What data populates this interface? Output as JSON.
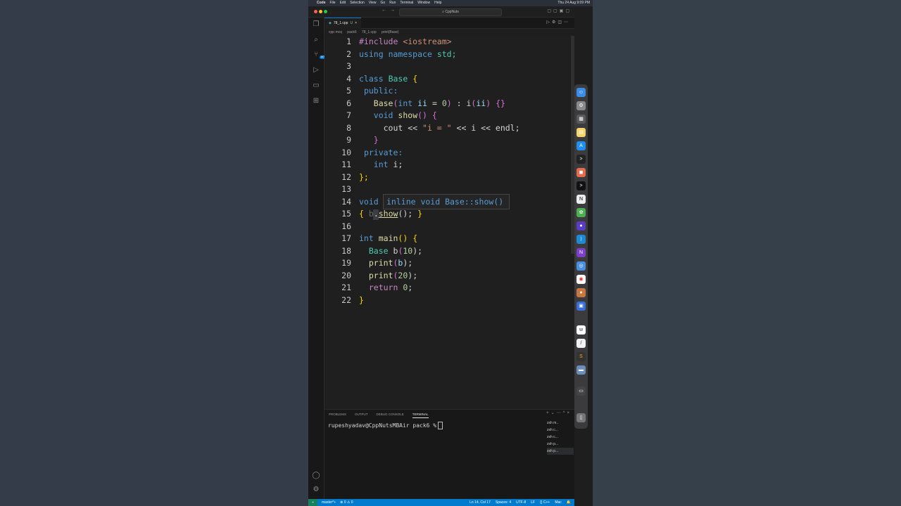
{
  "menubar": {
    "app": "Code",
    "items": [
      "File",
      "Edit",
      "Selection",
      "View",
      "Go",
      "Run",
      "Terminal",
      "Window",
      "Help"
    ],
    "clock": "Thu 24 Aug 9:09 PM"
  },
  "titlebar": {
    "search": "CppNuts"
  },
  "activity": {
    "scm_badge": "167"
  },
  "tab": {
    "filename": "78_1.cpp",
    "modified": "U",
    "close": "×"
  },
  "breadcrumb": {
    "parts": [
      "cpp mcq",
      "pack6",
      "78_1.cpp",
      "print(Base)"
    ]
  },
  "editor": {
    "line_numbers": [
      "1",
      "2",
      "3",
      "4",
      "5",
      "6",
      "7",
      "8",
      "9",
      "10",
      "11",
      "12",
      "13",
      "14",
      "15",
      "16",
      "17",
      "18",
      "19",
      "20",
      "21",
      "22"
    ],
    "hover": "inline void Base::show()"
  },
  "code": {
    "l1_a": "#include",
    "l1_b": "<iostream>",
    "l2_a": "using",
    "l2_b": "namespace",
    "l2_c": "std;",
    "l4_a": "class",
    "l4_b": "Base",
    "l4_c": "{",
    "l5": "public:",
    "l6_a": "Base",
    "l6_b": "(",
    "l6_c": "int",
    "l6_d": "ii",
    "l6_e": "=",
    "l6_f": "0",
    "l6_g": ")",
    "l6_h": ": i",
    "l6_i": "(",
    "l6_j": "ii",
    "l6_k": ")",
    "l6_l": "{}",
    "l7_a": "void",
    "l7_b": "show",
    "l7_c": "()",
    "l7_d": "{",
    "l8_a": "cout <<",
    "l8_b": "\"i = \"",
    "l8_c": "<< i << endl;",
    "l9": "}",
    "l10": "private:",
    "l11_a": "int",
    "l11_b": "i;",
    "l12": "};",
    "l14": "void",
    "l15_a": "{",
    "l15_b": "b",
    "l15_c": ".",
    "l15_d": "show",
    "l15_e": "();",
    "l15_f": "}",
    "l17_a": "int",
    "l17_b": "main",
    "l17_c": "()",
    "l17_d": "{",
    "l18_a": "Base",
    "l18_b": "b",
    "l18_c": "(",
    "l18_d": "10",
    "l18_e": ");",
    "l19_a": "print",
    "l19_b": "(",
    "l19_c": "b",
    "l19_d": ");",
    "l20_a": "print",
    "l20_b": "(",
    "l20_c": "20",
    "l20_d": ");",
    "l21_a": "return",
    "l21_b": "0",
    "l21_c": ";",
    "l22": "}"
  },
  "panel": {
    "tabs": [
      "PROBLEMS",
      "OUTPUT",
      "DEBUG CONSOLE",
      "TERMINAL"
    ],
    "prompt": "rupeshyadav@CppNutsMBAir pack6 %",
    "terminals": [
      "zsh m..",
      "zsh c...",
      "zsh c...",
      "zsh p...",
      "zsh p..."
    ]
  },
  "statusbar": {
    "branch": "master*+",
    "problems": "⊗ 0 ⚠ 0",
    "position": "Ln 14, Col 17",
    "spaces": "Spaces: 4",
    "encoding": "UTF-8",
    "eol": "LF",
    "language": "{} C++",
    "platform": "Mac"
  },
  "colors": {
    "accent": "#007acc",
    "editor_bg": "#1f1f1f"
  }
}
